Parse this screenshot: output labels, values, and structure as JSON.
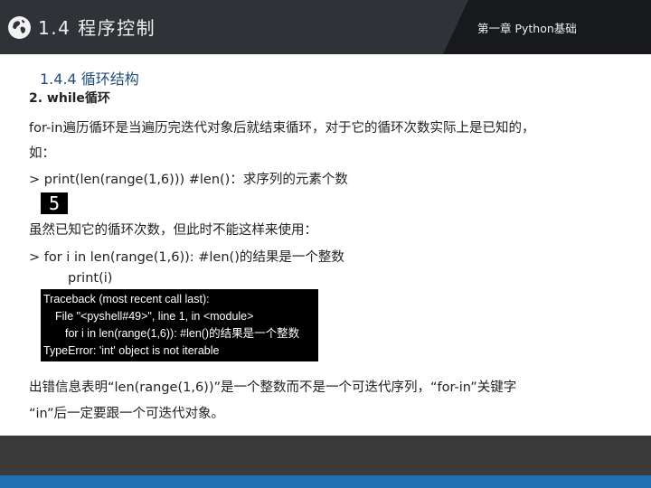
{
  "header": {
    "title": "1.4 程序控制",
    "chapter": "第一章 Python基础",
    "logo_icon": "globe-icon"
  },
  "content": {
    "section_heading": "1.4.4 循环结构",
    "sub_heading": "2. while循环",
    "paragraph1_line1": "for-in遍历循环是当遍历完迭代对象后就结束循环，对于它的循环次数实际上是已知的，",
    "paragraph1_line2": "如：",
    "code1": "> print(len(range(1,6)))   #len()：求序列的元素个数",
    "output1": "5",
    "paragraph2": "虽然已知它的循环次数，但此时不能这样来使用：",
    "code2_line1": "> for i in len(range(1,6)):  #len()的结果是一个整数",
    "code2_line2": "print(i)",
    "error_lines": [
      "Traceback (most recent call last):",
      "File \"<pyshell#49>\", line 1, in <module>",
      "for i in len(range(1,6)):     #len()的结果是一个整数",
      "TypeError: 'int' object is not iterable"
    ],
    "paragraph3_line1": "出错信息表明“len(range(1,6))”是一个整数而不是一个可迭代序列，“for-in”关键字",
    "paragraph3_line2": "“in”后一定要跟一个可迭代对象。"
  },
  "colors": {
    "header_bg": "#2f3236",
    "header_dark": "#17191c",
    "heading_blue": "#1f4e79",
    "footer_gray": "#3a3a3a",
    "footer_blue": "#1f70b3"
  }
}
